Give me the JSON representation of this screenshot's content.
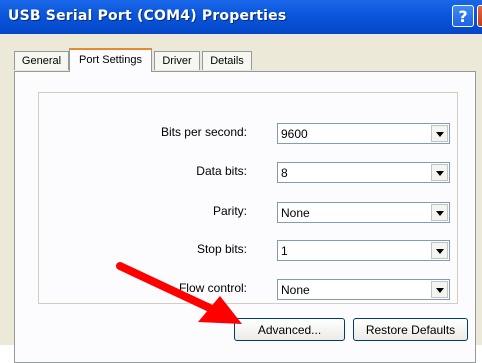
{
  "window": {
    "title": "USB Serial Port (COM4) Properties",
    "help_label": "?",
    "close_label": "✕"
  },
  "tabs": [
    {
      "label": "General",
      "active": false
    },
    {
      "label": "Port Settings",
      "active": true
    },
    {
      "label": "Driver",
      "active": false
    },
    {
      "label": "Details",
      "active": false
    }
  ],
  "settings": {
    "bits_per_second": {
      "label": "Bits per second:",
      "value": "9600"
    },
    "data_bits": {
      "label": "Data bits:",
      "value": "8"
    },
    "parity": {
      "label": "Parity:",
      "value": "None"
    },
    "stop_bits": {
      "label": "Stop bits:",
      "value": "1"
    },
    "flow_control": {
      "label": "Flow control:",
      "value": "None"
    }
  },
  "buttons": {
    "advanced": "Advanced...",
    "restore_defaults": "Restore Defaults"
  },
  "colors": {
    "titlebar": "#0a55db",
    "dialog_bg": "#ece9d8",
    "annotation_arrow": "#ff0000"
  }
}
